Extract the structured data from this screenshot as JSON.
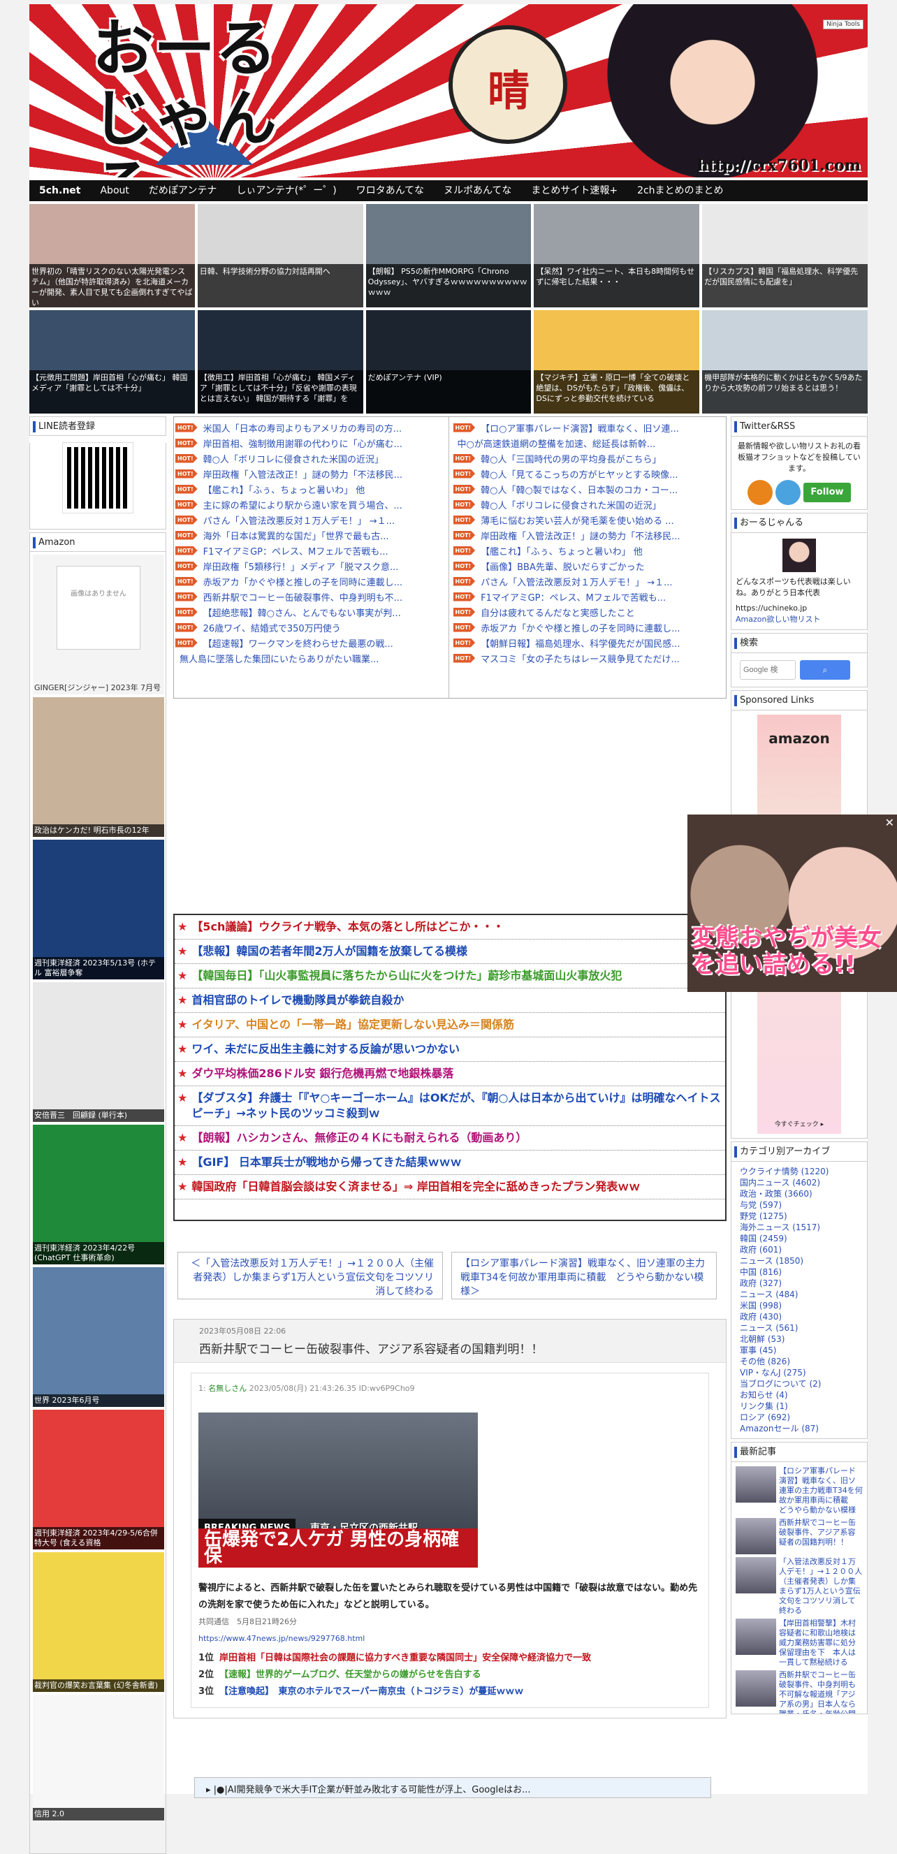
{
  "site": {
    "logo": "おーるじゃんる",
    "kanji": "晴",
    "url": "http://crx7601.com",
    "ninja": "Ninja Tools"
  },
  "nav": [
    "5ch.net",
    "About",
    "だめぽアンテナ",
    "しぃアンテナ(*゜ー゜)",
    "ワロタあんてな",
    "ヌルポあんてな",
    "まとめサイト速報+",
    "2chまとめのまとめ"
  ],
  "thumbs_row1": [
    {
      "caption": "世界初の「晴雪リスクのない太陽光発電システム」（他国が特許取得済み）を北海道メーカーが開発、素人目で見ても企画倒れすぎてやばい",
      "color": "#c9a9a0"
    },
    {
      "caption": "日韓、科学技術分野の協力対話再開へ",
      "color": "#d8d8d8"
    },
    {
      "caption": "【朗報】 PS5の新作MMORPG「Chrono Odyssey」、ヤバすぎるｗｗｗｗｗｗｗｗｗｗｗｗｗ",
      "color": "#6b7a86"
    },
    {
      "caption": "【呆然】ワイ社内ニート、本日も8時間何もせずに帰宅した結果・・・",
      "color": "#9aa0a6"
    },
    {
      "caption": "【リスカプス】韓国「福島処理水、科学優先だが国民感情にも配慮を」",
      "color": "#e9e9e9"
    }
  ],
  "thumbs_row2": [
    {
      "caption": "【元徴用工問題】岸田首相「心が痛む」 韓国メディア「謝罪としては不十分」",
      "color": "#3a4f6a"
    },
    {
      "caption": "【徴用工】岸田首相「心が痛む」 韓国メディア「謝罪としては不十分」「反省や謝罪の表現とは言えない」 韓国が期待する「謝罪」を",
      "color": "#1f2a3a"
    },
    {
      "caption": "だめぽアンテナ (VIP)",
      "color": "#1c2430"
    },
    {
      "caption": "【マジキチ】立憲・原口一博「全ての破壊と絶望は、DSがもたらす」「政権後、傀儡は、DSにずっと参勤交代を続けている",
      "color": "#f2c14e"
    },
    {
      "caption": "機甲部隊が本格的に動くかはともかく5/9あたりから大攻勢の前フリ始まるとは思う！",
      "color": "#c9d3dc"
    }
  ],
  "left": {
    "line_title": "LINE読者登録",
    "amazon_title": "Amazon",
    "books": [
      {
        "caption": "GINGER[ジンジャー] 2023年 7月号",
        "noimg": "画像はありません"
      },
      {
        "caption": "政治はケンカだ! 明石市長の12年"
      },
      {
        "caption": "週刊東洋経済 2023年5/13号 (ホテル 富裕層争奪"
      },
      {
        "caption": "安倍晋三　回顧録 (単行本)"
      },
      {
        "caption": "週刊東洋経済 2023年4/22号 (ChatGPT 仕事術革命)"
      },
      {
        "caption": "世界 2023年6月号"
      },
      {
        "caption": "週刊東洋経済 2023年4/29-5/6合併特大号 (食える資格"
      },
      {
        "caption": "裁判官の爆笑お言葉集 (幻冬舎新書)"
      },
      {
        "caption": "信用 2.0"
      }
    ]
  },
  "ranking_left": [
    {
      "hot": true,
      "text": "米国人「日本の寿司よりもアメリカの寿司の方..."
    },
    {
      "hot": true,
      "text": "岸田首相、強制徴用謝罪の代わりに「心が痛む..."
    },
    {
      "hot": true,
      "text": "韓○人「ボリコレに侵食された米国の近況」"
    },
    {
      "hot": true,
      "text": "岸田政権「入管法改正！」謎の勢力「不法移民..."
    },
    {
      "hot": true,
      "text": "【艦これ】「ふぅ、ちょっと暑いわ」 他"
    },
    {
      "hot": true,
      "text": "主に嫁の希望により駅から遠い家を買う場合、..."
    },
    {
      "hot": true,
      "text": "パさん「入管法改悪反対１万人デモ！」 →１..."
    },
    {
      "hot": true,
      "text": "海外「日本は驚異的な国だ」「世界で最も古..."
    },
    {
      "hot": true,
      "text": "F1マイアミGP：ペレス、Mフェルで苦戦も..."
    },
    {
      "hot": true,
      "text": "岸田政権「5類移行！」メディア「脱マスク意..."
    },
    {
      "hot": true,
      "text": "赤坂アカ「かぐや様と推しの子を同時に連載し..."
    },
    {
      "hot": true,
      "text": "西新井駅でコーヒー缶破裂事件、中身判明も不..."
    },
    {
      "hot": true,
      "text": "【超絶悲報】韓○さん、とんでもない事実が判..."
    },
    {
      "hot": true,
      "text": "26歳ワイ、結婚式で350万円使う"
    },
    {
      "hot": true,
      "text": "【超速報】ワークマンを終わらせた最悪の戦..."
    },
    {
      "hot": false,
      "text": "無人島に墜落した集団にいたらありがたい職業..."
    }
  ],
  "ranking_right": [
    {
      "hot": true,
      "text": "【ロ○ア軍事パレード演習】戦車なく、旧ソ連..."
    },
    {
      "hot": false,
      "text": "中○が高速鉄道網の整備を加速、総延長は新幹..."
    },
    {
      "hot": true,
      "text": "韓○人「三国時代の男の平均身長がこちら」"
    },
    {
      "hot": true,
      "text": "韓○人「見てるこっちの方がヒヤッとする映像..."
    },
    {
      "hot": true,
      "text": "韓○人「韓○製ではなく、日本製のコカ・コー..."
    },
    {
      "hot": true,
      "text": "韓○人「ボリコレに侵食された米国の近況」"
    },
    {
      "hot": true,
      "text": "薄毛に悩むお笑い芸人が発毛薬を使い始める ..."
    },
    {
      "hot": true,
      "text": "岸田政権「入管法改正！」謎の勢力「不法移民..."
    },
    {
      "hot": true,
      "text": "【艦これ】「ふぅ、ちょっと暑いわ」 他"
    },
    {
      "hot": true,
      "text": "【画像】BBA先輩、脱いだらすごかった"
    },
    {
      "hot": true,
      "text": "パさん「入管法改悪反対１万人デモ！」 →１..."
    },
    {
      "hot": true,
      "text": "F1マイアミGP：ペレス、Mフェルで苦戦も..."
    },
    {
      "hot": true,
      "text": "自分は疲れてるんだなと実感したこと"
    },
    {
      "hot": true,
      "text": "赤坂アカ「かぐや様と推しの子を同時に連載し..."
    },
    {
      "hot": true,
      "text": "【朝鮮日報】福島処理水、科学優先だが国民感..."
    },
    {
      "hot": true,
      "text": "マスコミ「女の子たちはレース競争見てただけ..."
    }
  ],
  "star_items": [
    {
      "text": "【5ch議論】ウクライナ戦争、本気の落とし所はどこか・・・",
      "color": "#c0141c"
    },
    {
      "text": "【悲報】韓国の若者年間2万人が国籍を放棄してる模様",
      "color": "#1b49b3"
    },
    {
      "text": "【韓国毎日】「山火事監視員に落ちたから山に火をつけた」蔚珍市基城面山火事放火犯",
      "color": "#3a9a2a"
    },
    {
      "text": "首相官邸のトイレで機動隊員が拳銃自殺か",
      "color": "#1b49b3"
    },
    {
      "text": "イタリア、中国との「一帯一路」協定更新しない見込み＝関係筋",
      "color": "#d7831d"
    },
    {
      "text": "ワイ、未だに反出生主義に対する反論が思いつかない",
      "color": "#1b49b3"
    },
    {
      "text": "ダウ平均株価286ドル安 銀行危機再燃で地銀株暴落",
      "color": "#b0127a"
    },
    {
      "text": "【ダブスタ】弁護士「『ヤ○キーゴーホーム』はOKだが、『朝○人は日本から出ていけ』は明確なヘイトスピーチ」→ネット民のツッコミ殺到ｗ",
      "color": "#1b49b3"
    },
    {
      "text": "【朗報】ハシカンさん、無修正の４Ｋにも耐えられる（動画あり）",
      "color": "#b0127a"
    },
    {
      "text": "【GIF】 日本軍兵士が戦地から帰ってきた結果ｗｗｗ",
      "color": "#1b49b3"
    },
    {
      "text": "韓国政府「日韓首脳会談は安く済ませる」⇒ 岸田首相を完全に舐めきったプラン発表ｗｗ",
      "color": "#c0141c"
    }
  ],
  "pager": {
    "prev": "＜「入管法改悪反対１万人デモ！」→１２００人（主催者発表）しか集まらず1万人という宣伝文句をコツソリ消して終わる",
    "next": "【ロシア軍事パレード演習】戦車なく、旧ソ連軍の主力戦車T34を何故か軍用車両に積載　どうやら動かない模様＞"
  },
  "article": {
    "date": "2023年05月08日 22:06",
    "title": "西新井駅でコーヒー缶破裂事件、アジア系容疑者の国籍判明！！",
    "meta_num": "1:",
    "meta_name": "名無しさん",
    "meta_rest": "2023/05/08(月) 21:43:26.35 ID:wv6P9Cho9",
    "photo_banner": "缶爆発で2人ケガ 男性の身柄確保",
    "photo_breaking": "BREAKING NEWS",
    "photo_loc": "東京・足立区の西新井駅",
    "body": "警視庁によると、西新井駅で破裂した缶を置いたとみられ聴取を受けている男性は中国籍で「破裂は故意ではない。勤め先の洗剤を家で使うため缶に入れた」などと説明している。",
    "source": "共同通信　5月8日21時26分",
    "link": "https://www.47news.jp/news/9297768.html",
    "ranking": [
      {
        "n": "1位",
        "text": "岸田首相「日韓は国際社会の課題に協力すべき重要な隣国同士」安全保障や経済協力で一致",
        "color": "#c0141c"
      },
      {
        "n": "2位",
        "text": "【速報】世界的ゲームブログ、任天堂からの嫌がらせを告白する",
        "color": "#3a9a2a"
      },
      {
        "n": "3位",
        "text": "【注意喚起】　東京のホテルでスーパー南京虫（トコジラミ）が蔓延ｗｗｗ",
        "color": "#1b49b3"
      }
    ],
    "bottom": "▸ |●|AI開発競争で米大手IT企業が軒並み敗北する可能性が浮上、Googleはお..."
  },
  "right": {
    "twitter_title": "Twitter&RSS",
    "twitter_desc": "最新情報や欲しい物リストお礼の看板猫オフショットなどを投稿しています。",
    "follow": "Follow",
    "profile_title": "おーるじゃんる",
    "profile_desc": "どんなスポーツも代表戦は楽しいね。ありがとう日本代表",
    "profile_link": "https://uchineko.jp",
    "profile_link2": "Amazon欲しい物リスト",
    "search_title": "検索",
    "search_placeholder": "Google 検",
    "sponsored_title": "Sponsored Links",
    "amazon": "amazon",
    "sponsored_cta": "今すぐチェック ▸",
    "category_title": "カテゴリ別アーカイブ",
    "categories": [
      "ウクライナ情勢 (1220)",
      "国内ニュース (4602)",
      "政治・政策 (3660)",
      "与党 (597)",
      "野党 (1275)",
      "海外ニュース (1517)",
      "韓国 (2459)",
      "政府 (601)",
      "ニュース (1850)",
      "中国 (816)",
      "政府 (327)",
      "ニュース (484)",
      "米国 (998)",
      "政府 (430)",
      "ニュース (561)",
      "北朝鮮 (53)",
      "軍事 (45)",
      "その他 (826)",
      "VIP・なんJ (275)",
      "当ブログについて (2)",
      "お知らせ (4)",
      "リンク集 (1)",
      "ロシア (692)",
      "Amazonセール (87)"
    ],
    "latest_title": "最新記事",
    "latest": [
      "【ロシア軍事パレード演習】戦車なく、旧ソ連軍の主力戦車T34を何故か軍用車両に積載　どうやら動かない模様",
      "西新井駅でコーヒー缶破裂事件、アジア系容疑者の国籍判明！！",
      "「入管法改悪反対１万人デモ！」→１２００人（主催者発表）しか集まらず1万人という宣伝文句をコツソリ消して終わる",
      "【岸田首相警撃】木村容疑者に和歌山地検は威力業務妨害罪に処分保留理由を下　本人は一貫して黙秘続ける",
      "西新井駅でコーヒー缶破裂事件、中身判明も不可解な報道規「アジア系の男」日本人なら職業・氏名・年齢公開"
    ]
  },
  "popup": {
    "text": "変態おやぢが美女を追い詰める!!",
    "close": "✕"
  }
}
